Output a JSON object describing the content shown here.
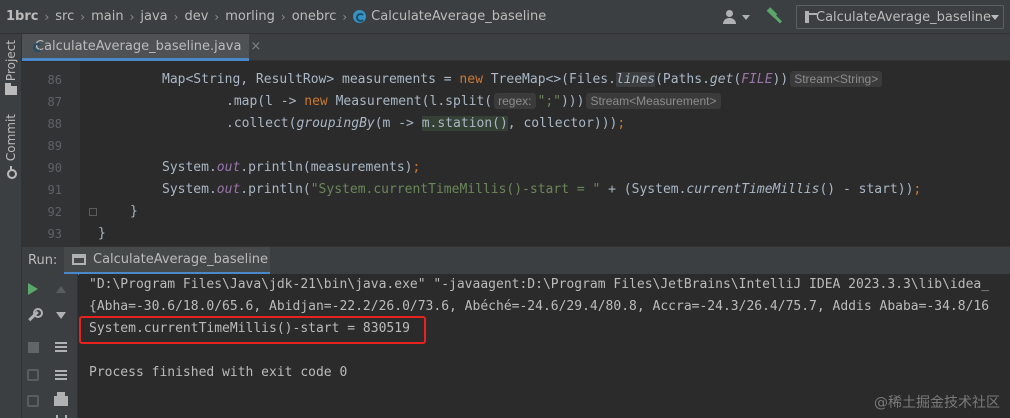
{
  "breadcrumb": [
    "1brc",
    "src",
    "main",
    "java",
    "dev",
    "morling",
    "onebrc",
    "CalculateAverage_baseline"
  ],
  "run_config": {
    "label": "CalculateAverage_baseline"
  },
  "left_strip": {
    "project_label": "Project",
    "commit_label": "Commit"
  },
  "editor_tab": {
    "label": "CalculateAverage_baseline.java",
    "close": "×"
  },
  "editor": {
    "line_numbers": [
      "86",
      "87",
      "88",
      "89",
      "90",
      "91",
      "92",
      "93"
    ],
    "line86": {
      "a": "Map<String, ResultRow> measurements = ",
      "new": "new",
      "b": " TreeMap<>(Files.",
      "lines": "lines",
      "c": "(Paths.",
      "get": "get",
      "d": "(",
      "file": "FILE",
      "e": "))",
      "hint": "Stream<String>"
    },
    "line87": {
      "a": ".map(l -> ",
      "new": "new",
      "b": " Measurement(l.split(",
      "hintkey": "regex:",
      "str": "\";\"",
      "c": ")))",
      "hint": "Stream<Measurement>"
    },
    "line88": {
      "a": ".collect(",
      "grouping": "groupingBy",
      "b": "(m -> ",
      "station": "m.station()",
      "c": ", collector)))",
      "semi": ";"
    },
    "line90": {
      "a": "System.",
      "out": "out",
      "b": ".println(measurements)",
      "semi": ";"
    },
    "line91": {
      "a": "System.",
      "out": "out",
      "b": ".println(",
      "str": "\"System.currentTimeMillis()-start = \"",
      "c": " + (System.",
      "ctm": "currentTimeMillis",
      "d": "() - start))",
      "semi": ";"
    },
    "line92": "}",
    "line93": "}"
  },
  "run_panel": {
    "label": "Run:",
    "tab_label": "CalculateAverage_baseline",
    "console": [
      "\"D:\\Program Files\\Java\\jdk-21\\bin\\java.exe\" \"-javaagent:D:\\Program Files\\JetBrains\\IntelliJ IDEA 2023.3.3\\lib\\idea_",
      "{Abha=-30.6/18.0/65.6, Abidjan=-22.2/26.0/73.6, Abéché=-24.6/29.4/80.8, Accra=-24.3/26.4/75.7, Addis Ababa=-34.8/16",
      "System.currentTimeMillis()-start = 830519",
      "",
      "Process finished with exit code 0"
    ]
  },
  "watermark": "@稀土掘金技术社区",
  "colors": {
    "highlight_box": "#e8231f",
    "accent": "#4a88c7",
    "run_green": "#59a869"
  }
}
